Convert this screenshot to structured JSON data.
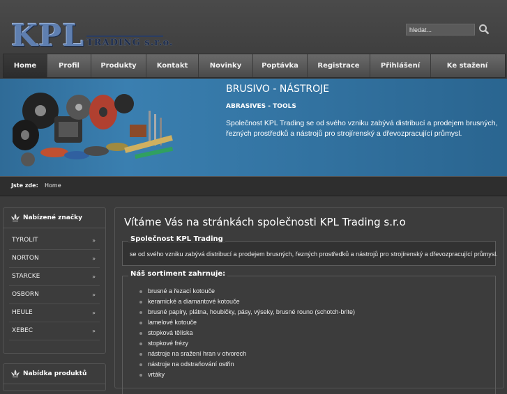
{
  "logo": {
    "big": "KPL",
    "small": "TRADING s.r.o."
  },
  "search": {
    "placeholder": "hledat..."
  },
  "nav": {
    "items": [
      "Home",
      "Profil",
      "Produkty",
      "Kontakt",
      "Novinky",
      "Poptávka",
      "Registrace",
      "Přihlášení",
      "Ke stažení"
    ],
    "active": "Home"
  },
  "banner": {
    "title": "BRUSIVO - NÁSTROJE",
    "subtitle": "ABRASIVES - TOOLS",
    "text": "Společnost KPL Trading se od svého vzniku zabývá distribucí a prodejem brusných, řezných prostředků a nástrojů pro strojírenský a dřevozpracující průmysl."
  },
  "breadcrumb": {
    "label": "Jste zde:",
    "home": "Home"
  },
  "sidebar": {
    "brands_title": "Nabízené značky",
    "brands": [
      "TYROLIT",
      "NORTON",
      "STARCKE",
      "OSBORN",
      "HEULE",
      "XEBEC"
    ],
    "products_title": "Nabídka produktů"
  },
  "main": {
    "title": "Vítáme Vás na stránkách společnosti KPL Trading s.r.o",
    "company_legend": "Společnost KPL Trading",
    "company_text": "se od svého vzniku zabývá distribucí a prodejem brusných, řezných prostředků a nástrojů pro strojírenský a dřevozpracující průmysl.",
    "range_legend": "Náš sortiment zahrnuje:",
    "range_items": [
      "brusné a řezací kotouče",
      "keramické a diamantové kotouče",
      "brusné papíry, plátna, houbičky, pásy, výseky, brusné rouno (schotch-brite)",
      "lamelové kotouče",
      "stopková tělíska",
      "stopkové frézy",
      "nástroje na sražení hran v otvorech",
      "nástroje na odstraňování ostřin",
      "vrtáky"
    ]
  },
  "colors": {
    "banner_blue": "#3a7fb0",
    "logo_blue": "#5f7fb0"
  },
  "icons": {
    "search": "search-icon",
    "fleur": "fleur-de-lis-icon",
    "arrow": "double-arrow-icon"
  }
}
